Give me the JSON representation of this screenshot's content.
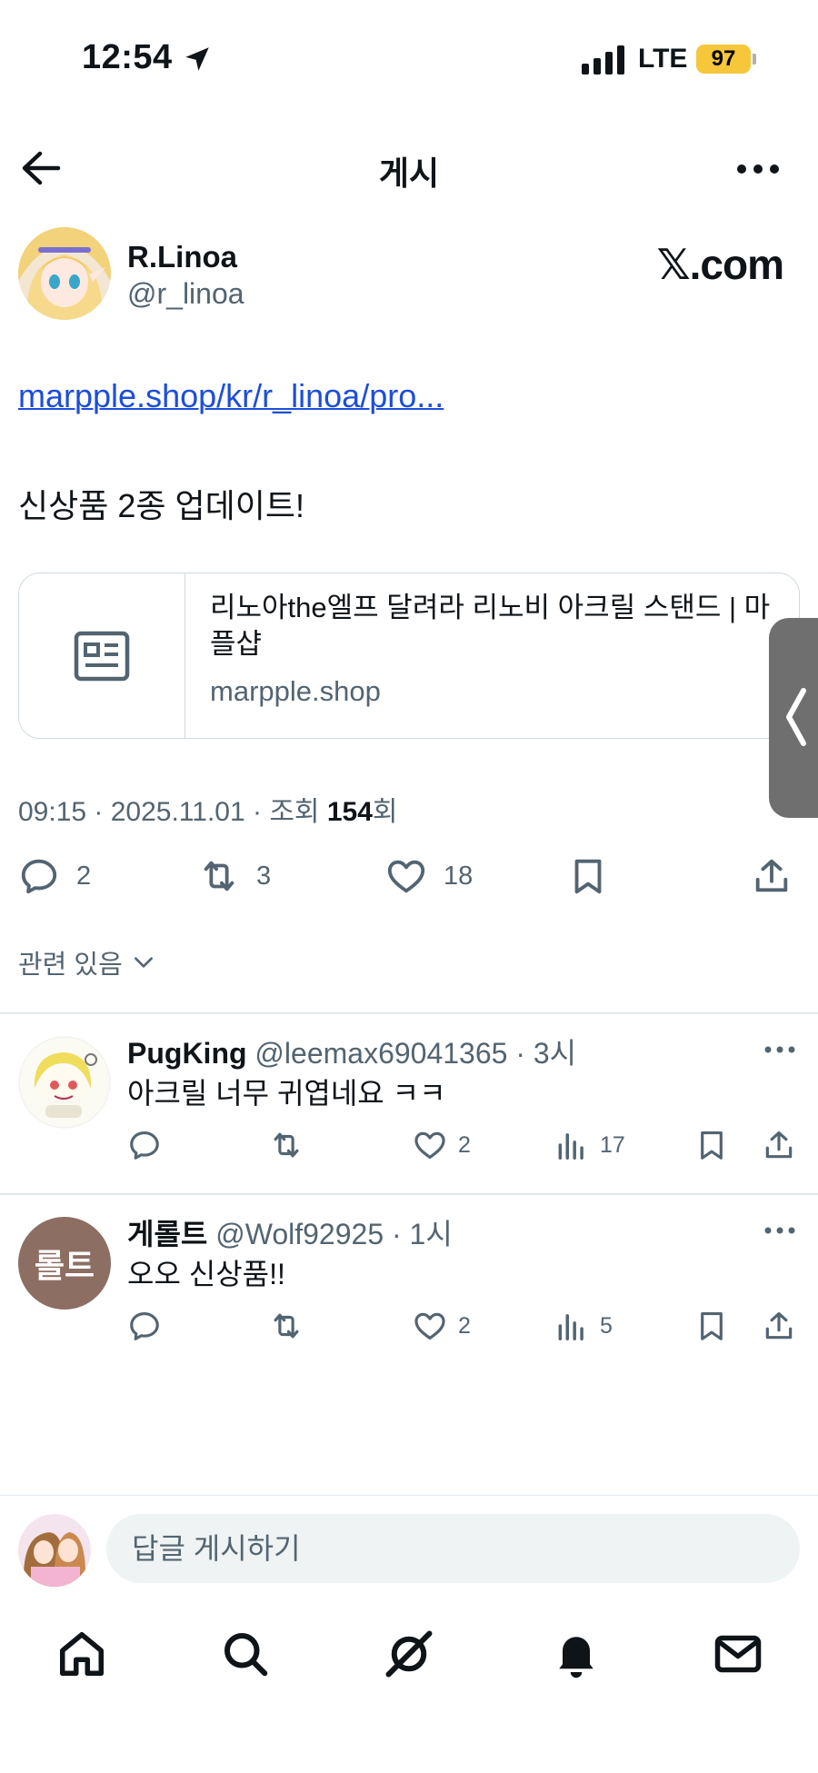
{
  "status_bar": {
    "time": "12:54",
    "network": "LTE",
    "battery": "97",
    "battery_color": "#f6c73a"
  },
  "nav": {
    "back_icon": "arrow-left-icon",
    "title": "게시",
    "more_icon": "more-horizontal-icon"
  },
  "post": {
    "author_name": "R.Linoa",
    "author_handle": "@r_linoa",
    "watermark": "𝕏.com",
    "link": "marpple.shop/kr/r_linoa/pro...",
    "text": "신상품 2종 업데이트!",
    "card": {
      "title": "리노아the엘프 달려라 리노비 아크릴 스탠드 | 마플샵",
      "domain": "marpple.shop",
      "icon": "article-icon"
    },
    "meta_prefix": "09:15 · 2025.11.01 · 조회 ",
    "views": "154",
    "views_suffix": "회",
    "actions": {
      "replies": "2",
      "reposts": "3",
      "likes": "18"
    },
    "related": "관련 있음"
  },
  "replies": [
    {
      "name": "PugKing",
      "handle": "@leemax69041365",
      "time": "· 3시",
      "text": "아크릴 너무 귀엽네요 ㅋㅋ",
      "likes": "2",
      "views": "17"
    },
    {
      "name": "게롤트",
      "handle": "@Wolf92925",
      "time": "· 1시",
      "text": "오오 신상품!!",
      "likes": "2",
      "views": "5",
      "avatar_text": "롤트",
      "avatar_color": "#8d6e63"
    }
  ],
  "compose": {
    "placeholder": "답글 게시하기"
  },
  "tabs": [
    "home-icon",
    "search-icon",
    "grok-icon",
    "notifications-icon",
    "messages-icon"
  ],
  "colors": {
    "link": "#1d4ed8",
    "text_primary": "#0f1419",
    "text_secondary": "#536471"
  }
}
